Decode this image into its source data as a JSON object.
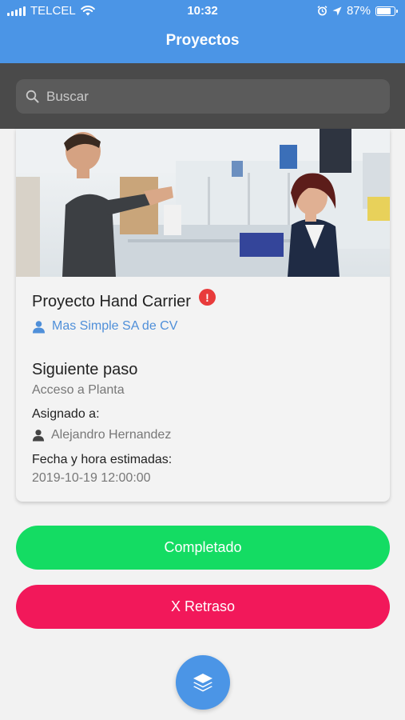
{
  "status_bar": {
    "carrier": "TELCEL",
    "time": "10:32",
    "battery": "87%",
    "battery_level": 0.87
  },
  "header": {
    "title": "Proyectos"
  },
  "search": {
    "placeholder": "Buscar"
  },
  "project": {
    "name": "Proyecto Hand Carrier",
    "alert_symbol": "!",
    "company": "Mas Simple SA de CV",
    "next_step_title": "Siguiente paso",
    "next_step_value": "Acceso a Planta",
    "assigned_label": "Asignado a:",
    "assigned_value": "Alejandro Hernandez",
    "date_label": "Fecha y hora estimadas:",
    "date_value": "2019-10-19 12:00:00"
  },
  "actions": {
    "completed_label": "Completado",
    "delay_label": "X Retraso"
  },
  "colors": {
    "primary": "#4b95e6",
    "success": "#14dc63",
    "danger": "#f2185a",
    "alert": "#e83b3b"
  },
  "icons": [
    "signal-icon",
    "wifi-icon",
    "alarm-icon",
    "location-icon",
    "battery-icon",
    "search-icon",
    "user-icon",
    "layers-icon"
  ]
}
